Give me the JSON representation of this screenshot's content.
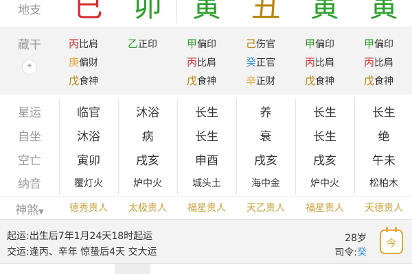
{
  "top": {
    "label": "地支",
    "chars": [
      {
        "text": "巳",
        "color": "#d32f2f"
      },
      {
        "text": "卯",
        "color": "#2ca02c"
      },
      {
        "text": "寅",
        "color": "#2ca02c"
      },
      {
        "text": "丑",
        "color": "#b8860b"
      },
      {
        "text": "寅",
        "color": "#2ca02c"
      },
      {
        "text": "寅",
        "color": "#2ca02c"
      }
    ]
  },
  "hidden_stems": {
    "label": "藏干",
    "columns": [
      [
        {
          "stem": "丙",
          "god": "比肩",
          "color": "#d32f2f"
        },
        {
          "stem": "庚",
          "god": "偏财",
          "color": "#e6a23c"
        },
        {
          "stem": "戊",
          "god": "食神",
          "color": "#b8860b"
        }
      ],
      [
        {
          "stem": "乙",
          "god": "正印",
          "color": "#2ca02c"
        }
      ],
      [
        {
          "stem": "甲",
          "god": "偏印",
          "color": "#2ca02c"
        },
        {
          "stem": "丙",
          "god": "比肩",
          "color": "#d32f2f"
        },
        {
          "stem": "戊",
          "god": "食神",
          "color": "#b8860b"
        }
      ],
      [
        {
          "stem": "己",
          "god": "伤官",
          "color": "#b8860b"
        },
        {
          "stem": "癸",
          "god": "正官",
          "color": "#3a8fd6"
        },
        {
          "stem": "辛",
          "god": "正财",
          "color": "#e6a23c"
        }
      ],
      [
        {
          "stem": "甲",
          "god": "偏印",
          "color": "#2ca02c"
        },
        {
          "stem": "丙",
          "god": "比肩",
          "color": "#d32f2f"
        },
        {
          "stem": "戊",
          "god": "食神",
          "color": "#b8860b"
        }
      ],
      [
        {
          "stem": "甲",
          "god": "偏印",
          "color": "#2ca02c"
        },
        {
          "stem": "丙",
          "god": "比肩",
          "color": "#d32f2f"
        },
        {
          "stem": "戊",
          "god": "食神",
          "color": "#b8860b"
        }
      ]
    ]
  },
  "grid": {
    "rows": [
      {
        "label": "星运",
        "values": [
          "临官",
          "沐浴",
          "长生",
          "养",
          "长生",
          "长生"
        ]
      },
      {
        "label": "自坐",
        "values": [
          "沐浴",
          "病",
          "长生",
          "衰",
          "长生",
          "绝"
        ]
      },
      {
        "label": "空亡",
        "values": [
          "寅卯",
          "戌亥",
          "申酉",
          "戌亥",
          "戌亥",
          "午未"
        ]
      },
      {
        "label": "纳音",
        "values": [
          "覆灯火",
          "炉中火",
          "城头土",
          "海中金",
          "炉中火",
          "松柏木"
        ]
      }
    ]
  },
  "shensha": {
    "label": "神煞",
    "items": [
      "德秀贵人",
      "太极贵人",
      "福星贵人",
      "天乙贵人",
      "福星贵人",
      "天德贵人"
    ]
  },
  "bottom": {
    "qiyun_label": "起运:",
    "qiyun_text": "出生后7年1月24天18时起运",
    "jiaoyun_label": "交运:",
    "jiaoyun_text": "逢丙、辛年 惊蛰后4天 交大运",
    "age": "28岁",
    "siling_label": "司令:",
    "siling_value": "癸",
    "calendar_glyph": "今"
  }
}
